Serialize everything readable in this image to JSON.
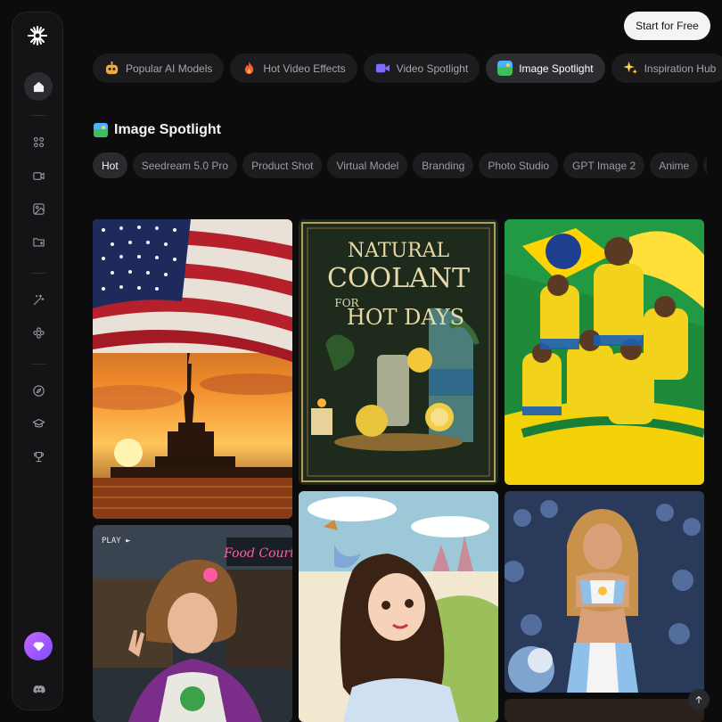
{
  "topbar": {
    "cta_label": "Start for Free"
  },
  "sidebar": {
    "items": [
      "home",
      "apps",
      "video",
      "image",
      "assets",
      "magic",
      "effects",
      "explore",
      "learn",
      "awards"
    ]
  },
  "nav": {
    "tabs": [
      {
        "label": "Popular AI Models",
        "icon": "robot-emoji",
        "active": false
      },
      {
        "label": "Hot Video Effects",
        "icon": "fire-emoji",
        "active": false
      },
      {
        "label": "Video Spotlight",
        "icon": "video-camera-icon",
        "active": false
      },
      {
        "label": "Image Spotlight",
        "icon": "image-icon",
        "active": true
      },
      {
        "label": "Inspiration Hub",
        "icon": "sparkles-emoji",
        "active": false
      }
    ]
  },
  "section": {
    "title": "Image Spotlight",
    "chips": [
      "Hot",
      "Seedream 5.0 Pro",
      "Product Shot",
      "Virtual Model",
      "Branding",
      "Photo Studio",
      "GPT Image 2",
      "Anime",
      "N"
    ]
  },
  "gallery": {
    "card2_line1": "NATURAL",
    "card2_line2": "COOLANT",
    "card2_line3": "FOR",
    "card2_line4": "HOT DAYS",
    "card4_play": "PLAY ►",
    "card4_sign": "Food Court"
  },
  "colors": {
    "accent": "#a35cff",
    "bg": "#0c0c0d"
  }
}
